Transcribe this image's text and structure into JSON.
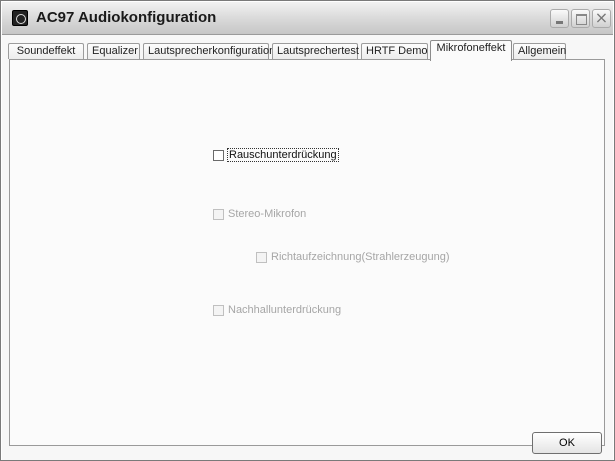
{
  "window": {
    "title": "AC97 Audiokonfiguration",
    "icon": "speaker-app-icon",
    "controls": [
      "minimize-icon",
      "maximize-icon",
      "close-icon"
    ]
  },
  "tabs": [
    {
      "label": "Soundeffekt",
      "active": false
    },
    {
      "label": "Equalizer",
      "active": false
    },
    {
      "label": "Lautsprecherkonfiguration",
      "active": false
    },
    {
      "label": "Lautsprechertest",
      "active": false
    },
    {
      "label": "HRTF Demo",
      "active": false
    },
    {
      "label": "Mikrofoneffekt",
      "active": true
    },
    {
      "label": "Allgemein",
      "active": false
    }
  ],
  "options": {
    "noise_suppression": {
      "label": "Rauschunterdrückung",
      "checked": false,
      "enabled": true
    },
    "stereo_mic": {
      "label": "Stereo-Mikrofon",
      "checked": false,
      "enabled": false
    },
    "beamforming": {
      "label": "Richtaufzeichnung(Strahlerzeugung)",
      "checked": false,
      "enabled": false
    },
    "echo_cancellation": {
      "label": "Nachhallunterdrückung",
      "checked": false,
      "enabled": false
    }
  },
  "buttons": {
    "ok": "OK"
  },
  "colors": {
    "disabled_text": "#a6a6a6",
    "panel_background": "#fbfbfb"
  }
}
